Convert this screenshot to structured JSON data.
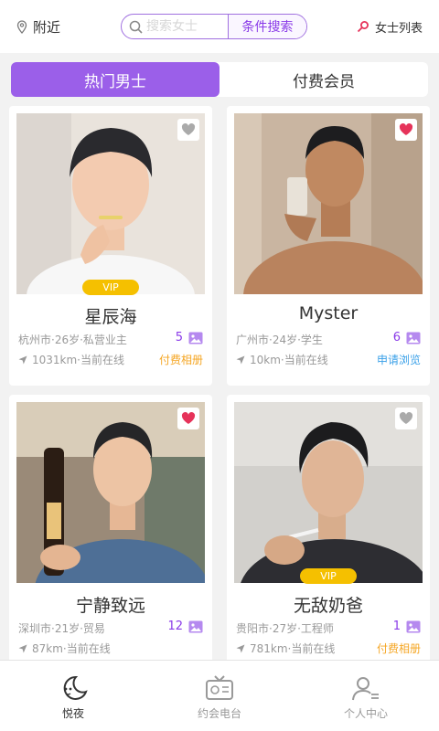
{
  "header": {
    "location_label": "附近",
    "search_placeholder": "搜索女士",
    "search_button": "条件搜索",
    "ladies_list": "女士列表"
  },
  "tabs": [
    {
      "label": "热门男士",
      "active": true
    },
    {
      "label": "付费会员",
      "active": false
    }
  ],
  "cards": [
    {
      "name": "星辰海",
      "meta": "杭州市·26岁·私营业主",
      "photo_count": "5",
      "distance": "1031km·当前在线",
      "action": "付费相册",
      "action_color": "#f5a623",
      "vip": "VIP",
      "favorited": false
    },
    {
      "name": "Myster",
      "meta": "广州市·24岁·学生",
      "photo_count": "6",
      "distance": "10km·当前在线",
      "action": "申请浏览",
      "action_color": "#3aa0e8",
      "vip": null,
      "favorited": true
    },
    {
      "name": "宁静致远",
      "meta": "深圳市·21岁·贸易",
      "photo_count": "12",
      "distance": "87km·当前在线",
      "action": "",
      "action_color": "#f5a623",
      "vip": null,
      "favorited": true
    },
    {
      "name": "无敌奶爸",
      "meta": "贵阳市·27岁·工程师",
      "photo_count": "1",
      "distance": "781km·当前在线",
      "action": "付费相册",
      "action_color": "#f5a623",
      "vip": "VIP",
      "favorited": false
    }
  ],
  "bottom_nav": [
    {
      "label": "悦夜",
      "icon": "moon-icon",
      "active": true
    },
    {
      "label": "约会电台",
      "icon": "radio-icon",
      "active": false
    },
    {
      "label": "个人中心",
      "icon": "person-icon",
      "active": false
    }
  ],
  "colors": {
    "accent": "#9b5fe9",
    "vip": "#f5c000",
    "heart": "#e6335a"
  }
}
